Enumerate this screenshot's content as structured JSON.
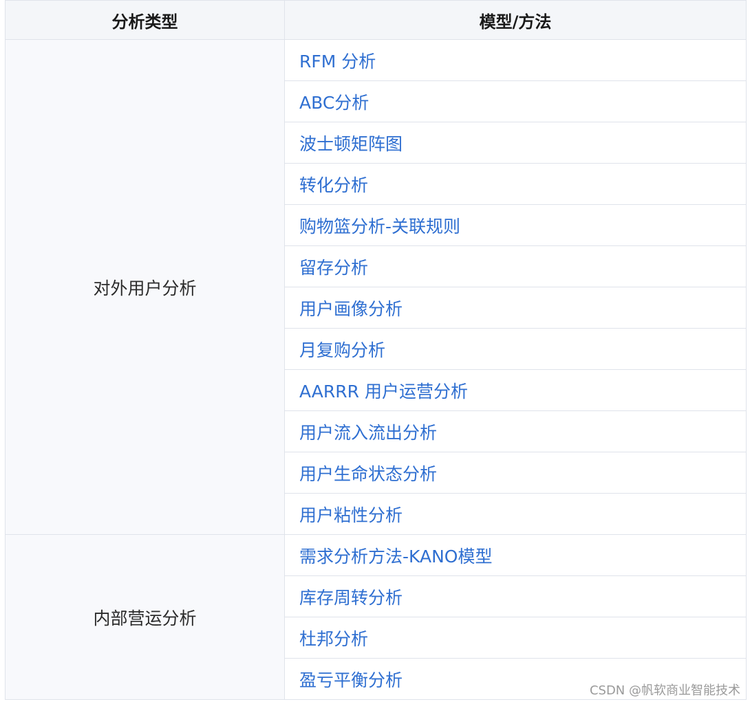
{
  "table": {
    "headers": {
      "type": "分析类型",
      "method": "模型/方法"
    },
    "groups": [
      {
        "type": "对外用户分析",
        "methods": [
          "RFM 分析",
          "ABC分析",
          "波士顿矩阵图",
          "转化分析",
          "购物篮分析-关联规则",
          "留存分析",
          "用户画像分析",
          "月复购分析",
          "AARRR 用户运营分析",
          "用户流入流出分析",
          "用户生命状态分析",
          "用户粘性分析"
        ]
      },
      {
        "type": "内部营运分析",
        "methods": [
          "需求分析方法-KANO模型",
          "库存周转分析",
          "杜邦分析",
          "盈亏平衡分析"
        ]
      }
    ]
  },
  "watermark": "CSDN @帆软商业智能技术",
  "colors": {
    "link": "#2f6fd1",
    "header_bg": "#f4f6f9",
    "border": "#dfe3ea"
  }
}
